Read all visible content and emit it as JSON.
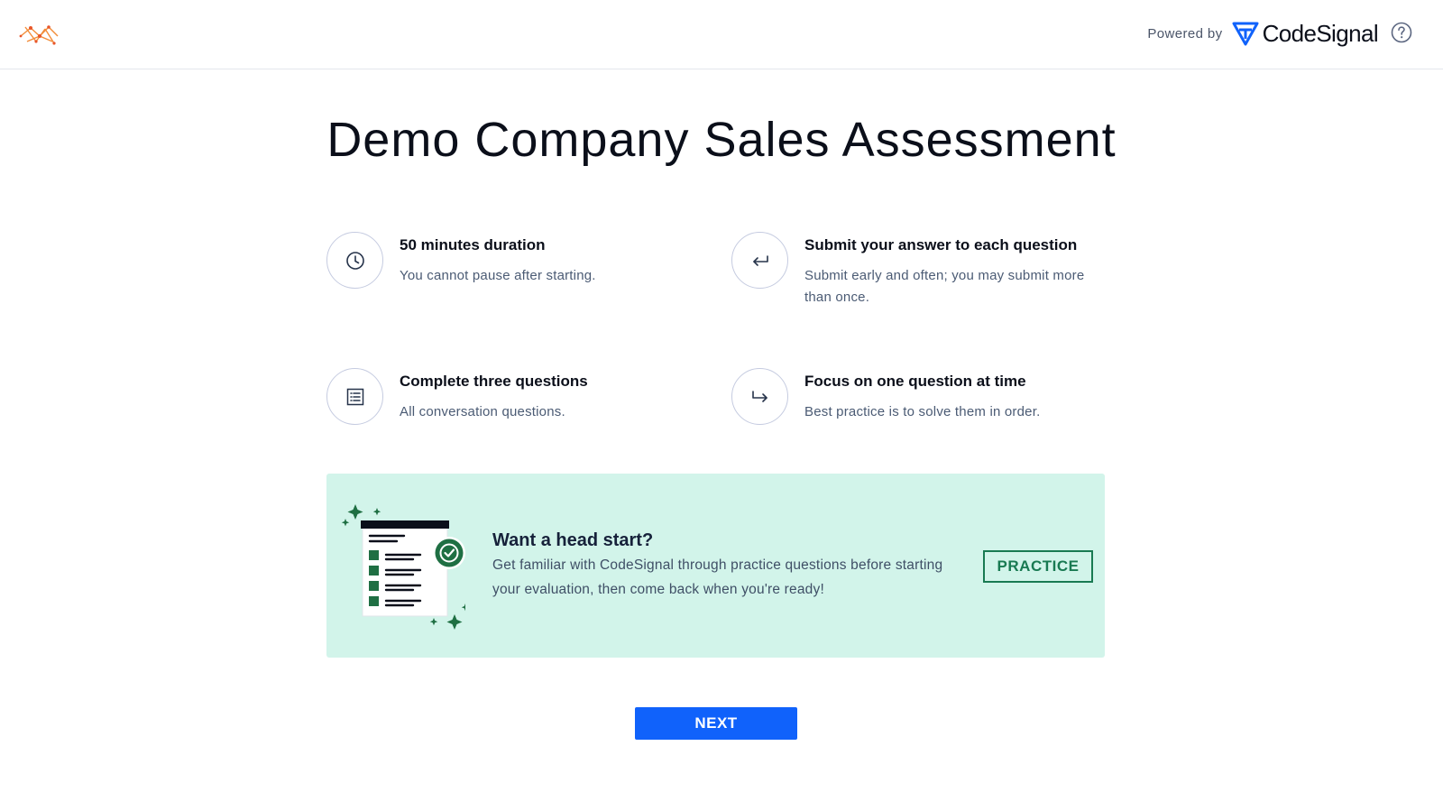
{
  "header": {
    "powered_by": "Powered by",
    "brand_name": "CodeSignal",
    "logo_icon": "company-network-logo",
    "help_icon": "question-circle-icon"
  },
  "page": {
    "title": "Demo Company Sales Assessment"
  },
  "features": [
    {
      "icon": "clock-icon",
      "title": "50 minutes duration",
      "description": "You cannot pause after starting."
    },
    {
      "icon": "return-arrow-icon",
      "title": "Submit your answer to each question",
      "description": "Submit early and often; you may submit more than once."
    },
    {
      "icon": "list-icon",
      "title": "Complete three questions",
      "description": "All conversation questions."
    },
    {
      "icon": "forward-arrow-icon",
      "title": "Focus on one question at time",
      "description": "Best practice is to solve them in order."
    }
  ],
  "promo": {
    "title": "Want a head start?",
    "description": "Get familiar with CodeSignal through practice questions before starting your evaluation, then come back when you're ready!",
    "button_label": "PRACTICE",
    "illustration": "checklist-illustration"
  },
  "footer": {
    "next_label": "NEXT"
  },
  "colors": {
    "primary_button": "#1062fb",
    "promo_background": "#d2f4ea",
    "practice_green": "#197a52",
    "brand_blue": "#1062fb"
  }
}
